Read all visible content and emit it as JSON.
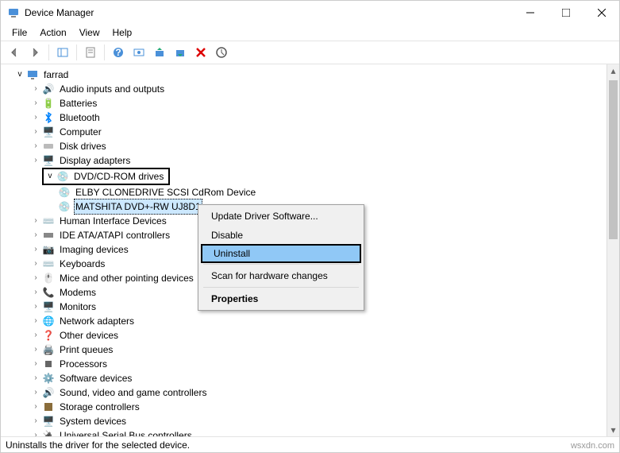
{
  "window": {
    "title": "Device Manager"
  },
  "menu": {
    "file": "File",
    "action": "Action",
    "view": "View",
    "help": "Help"
  },
  "tree": {
    "root": "farrad",
    "audio": "Audio inputs and outputs",
    "batteries": "Batteries",
    "bluetooth": "Bluetooth",
    "computer": "Computer",
    "disk": "Disk drives",
    "display": "Display adapters",
    "dvd": "DVD/CD-ROM drives",
    "dvd_child1": "ELBY CLONEDRIVE SCSI CdRom Device",
    "dvd_child2": "MATSHITA DVD+-RW UJ8D1",
    "hid": "Human Interface Devices",
    "ide": "IDE ATA/ATAPI controllers",
    "imaging": "Imaging devices",
    "keyboards": "Keyboards",
    "mice": "Mice and other pointing devices",
    "modems": "Modems",
    "monitors": "Monitors",
    "network": "Network adapters",
    "other": "Other devices",
    "print": "Print queues",
    "processors": "Processors",
    "software": "Software devices",
    "sound": "Sound, video and game controllers",
    "storage": "Storage controllers",
    "system": "System devices",
    "usb": "Universal Serial Bus controllers"
  },
  "ctx": {
    "update": "Update Driver Software...",
    "disable": "Disable",
    "uninstall": "Uninstall",
    "scan": "Scan for hardware changes",
    "properties": "Properties"
  },
  "status": "Uninstalls the driver for the selected device.",
  "watermark": "wsxdn.com"
}
